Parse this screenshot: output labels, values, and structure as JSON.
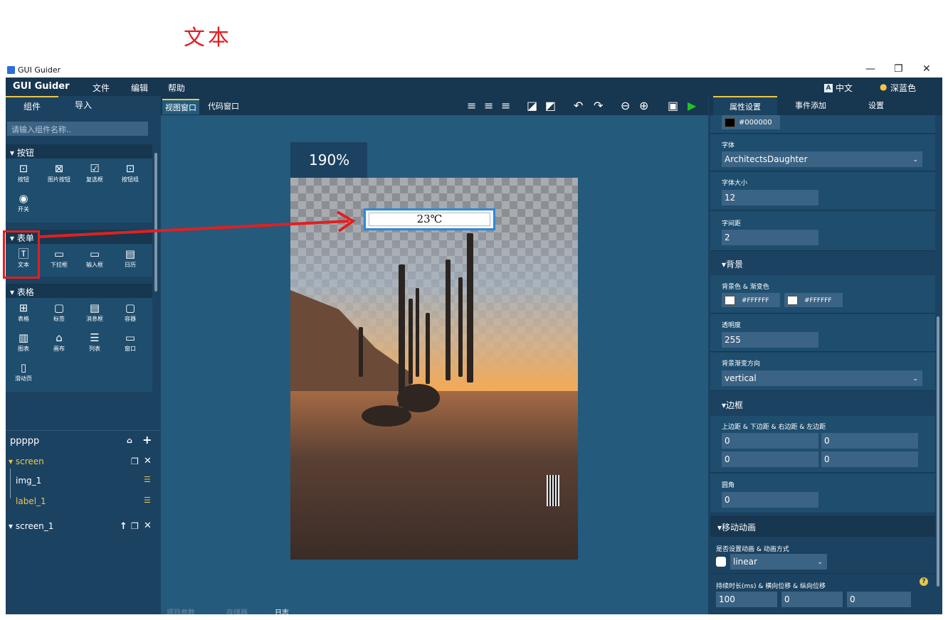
{
  "caption": "文本",
  "window": {
    "title": "GUI Guider",
    "controls": [
      "—",
      "❐",
      "✕"
    ]
  },
  "menubar": {
    "brand": "GUI Guider",
    "items": [
      "文件",
      "编辑",
      "帮助"
    ],
    "language": "中文",
    "theme": "深蓝色"
  },
  "left": {
    "tabs": [
      "组件",
      "导入"
    ],
    "search_placeholder": "请输入组件名称..",
    "sections": [
      {
        "title": "▾ 按钮",
        "items": [
          {
            "label": "按钮",
            "icon": "button-icon"
          },
          {
            "label": "图片按钮",
            "icon": "image-button-icon"
          },
          {
            "label": "复选框",
            "icon": "checkbox-icon"
          },
          {
            "label": "按钮组",
            "icon": "button-group-icon"
          },
          {
            "label": "开关",
            "icon": "switch-icon"
          }
        ]
      },
      {
        "title": "▾ 表单",
        "items": [
          {
            "label": "文本",
            "icon": "text-icon"
          },
          {
            "label": "下拉框",
            "icon": "dropdown-icon"
          },
          {
            "label": "输入框",
            "icon": "input-icon"
          },
          {
            "label": "日历",
            "icon": "calendar-icon"
          }
        ]
      },
      {
        "title": "▾ 表格",
        "items": [
          {
            "label": "表格",
            "icon": "table-icon"
          },
          {
            "label": "标签",
            "icon": "label-icon"
          },
          {
            "label": "消息框",
            "icon": "message-box-icon"
          },
          {
            "label": "容器",
            "icon": "container-icon"
          },
          {
            "label": "图表",
            "icon": "chart-icon"
          },
          {
            "label": "画布",
            "icon": "canvas-icon"
          },
          {
            "label": "列表",
            "icon": "list-icon"
          },
          {
            "label": "窗口",
            "icon": "window-icon"
          },
          {
            "label": "滑动页",
            "icon": "tileview-icon"
          }
        ]
      }
    ],
    "project": "ppppp",
    "tree": {
      "screen": "screen",
      "img": "img_1",
      "label": "label_1",
      "screen1": "screen_1"
    }
  },
  "center": {
    "tabs": [
      "视图窗口",
      "代码窗口"
    ],
    "zoom": "190%",
    "text_widget_value": "23℃",
    "bottom_tabs": [
      "项目参数",
      "存储器",
      "日志"
    ]
  },
  "right": {
    "tabs": [
      "属性设置",
      "事件添加",
      "设置"
    ],
    "text_color": "#000000",
    "font_label": "字体",
    "font_value": "ArchitectsDaughter",
    "font_size_label": "字体大小",
    "font_size": "12",
    "letter_spacing_label": "字间距",
    "letter_spacing": "2",
    "bg_group": "▾背景",
    "bg_color_label": "背景色 & 渐变色",
    "bg_color_1": "#FFFFFF",
    "bg_color_2": "#FFFFFF",
    "opacity_label": "透明度",
    "opacity": "255",
    "grad_dir_label": "背景渐变方向",
    "grad_dir": "vertical",
    "border_group": "▾边框",
    "padding_label": "上边距 & 下边距 & 右边距 & 左边距",
    "pad_top": "0",
    "pad_bottom": "0",
    "pad_right": "0",
    "pad_left": "0",
    "radius_label": "圆角",
    "radius": "0",
    "anim_group": "▾移动动画",
    "anim_label": "是否设置动画 & 动画方式",
    "anim_mode": "linear",
    "duration_label": "持续时长(ms) & 横向位移 & 纵向位移",
    "duration": "100",
    "dx": "0",
    "dy": "0"
  },
  "colors": {
    "window_bg": "#1c4261",
    "accent_red": "#e02020",
    "selection_blue": "#2e88d8",
    "run_green": "#22c02a",
    "tree_highlight": "#e8c84a"
  }
}
